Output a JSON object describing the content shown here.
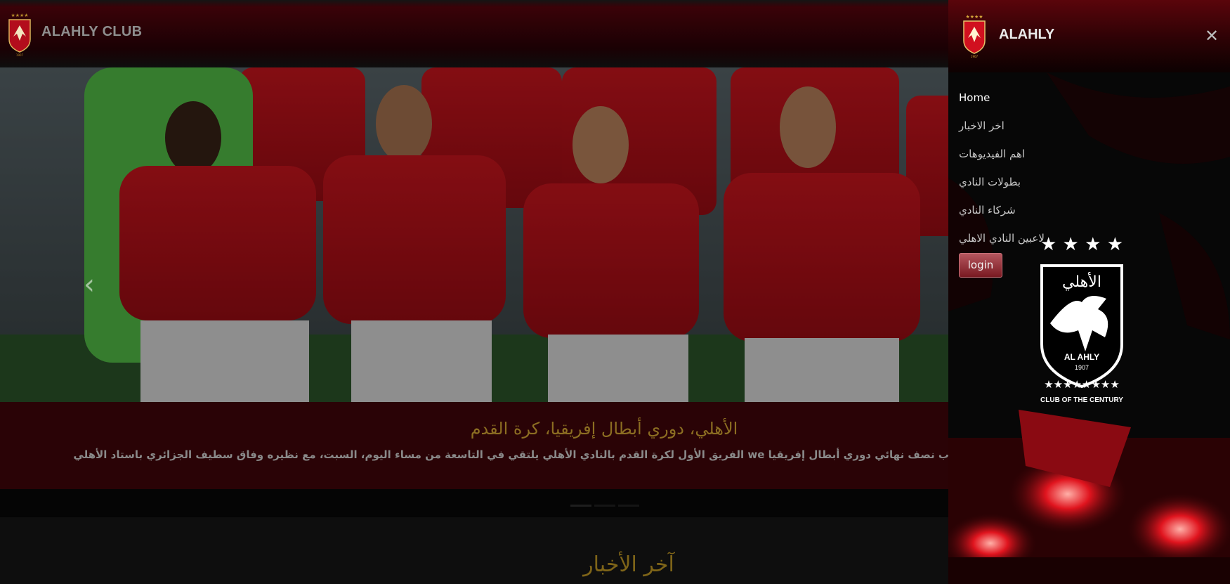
{
  "navbar": {
    "brand": "ALAHLY CLUB",
    "logo_icon": "alahly-logo-icon"
  },
  "carousel": {
    "prev_symbol": "‹",
    "caption_title": "الأهلي، دوري أبطال إفريقيا، كرة القدم",
    "caption_text": "ب نصف نهائي دوري أبطال إفريقيا we الفريق الأول لكرة القدم بالنادي الأهلي يلتقي في التاسعة من مساء اليوم، السبت، مع نظيره وفاق سطيف الجزائري باستاد الأهلي",
    "indicator_count": 3,
    "active_indicator": 0
  },
  "news": {
    "heading": "آخر الأخبار"
  },
  "offcanvas": {
    "title": "ALAHLY",
    "close_symbol": "✕",
    "menu": [
      {
        "label": "Home",
        "active": true
      },
      {
        "label": "اخر الاخبار",
        "active": false
      },
      {
        "label": "اهم الفيديوهات",
        "active": false
      },
      {
        "label": "بطولات النادي",
        "active": false
      },
      {
        "label": "شركاء النادي",
        "active": false
      },
      {
        "label": "لاعبين النادي الاهلي",
        "active": false
      }
    ],
    "login_label": "login",
    "crest": {
      "arabic_name": "الأهلي",
      "latin_name": "AL AHLY",
      "year": "1907",
      "motto": "CLUB OF THE CENTURY",
      "stars": "★ ★ ★ ★"
    }
  },
  "colors": {
    "brand_red": "#c8102e",
    "caption_gold": "#8c6e22",
    "sidebar_header": "#5a050b"
  }
}
